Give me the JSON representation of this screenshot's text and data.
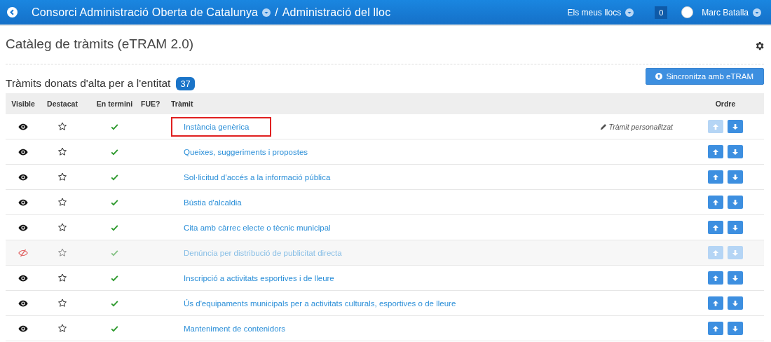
{
  "header": {
    "org": "Consorci Administració Oberta de Catalunya",
    "separator": "/",
    "section": "Administració del lloc",
    "sites_menu": "Els meus llocs",
    "notifications": "0",
    "user": "Marc Batalla"
  },
  "page": {
    "title": "Catàleg de tràmits (eTRAM 2.0)",
    "subtitle": "Tràmits donats d'alta per a l'entitat",
    "count": "37",
    "sync_button": "Sincronitza amb eTRAM"
  },
  "table": {
    "columns": [
      "Visible",
      "Destacat",
      "En termini",
      "FUE?",
      "Tràmit",
      "Ordre"
    ],
    "rows": [
      {
        "visible": true,
        "featured": false,
        "in_term": true,
        "title": "Instància genèrica",
        "highlighted": true,
        "note": "Tràmit personalitzat",
        "disabled": false,
        "up_disabled": true,
        "down_disabled": false
      },
      {
        "visible": true,
        "featured": false,
        "in_term": true,
        "title": "Queixes, suggeriments i propostes",
        "highlighted": false,
        "disabled": false,
        "up_disabled": false,
        "down_disabled": false
      },
      {
        "visible": true,
        "featured": false,
        "in_term": true,
        "title": "Sol·licitud d'accés a la informació pública",
        "highlighted": false,
        "disabled": false,
        "up_disabled": false,
        "down_disabled": false
      },
      {
        "visible": true,
        "featured": false,
        "in_term": true,
        "title": "Bústia d'alcaldia",
        "highlighted": false,
        "disabled": false,
        "up_disabled": false,
        "down_disabled": false
      },
      {
        "visible": true,
        "featured": false,
        "in_term": true,
        "title": "Cita amb càrrec electe o tècnic municipal",
        "highlighted": false,
        "disabled": false,
        "up_disabled": false,
        "down_disabled": false
      },
      {
        "visible": false,
        "featured": false,
        "in_term": true,
        "title": "Denúncia per distribució de publicitat directa",
        "highlighted": false,
        "disabled": true,
        "up_disabled": true,
        "down_disabled": true
      },
      {
        "visible": true,
        "featured": false,
        "in_term": true,
        "title": "Inscripció a activitats esportives i de lleure",
        "highlighted": false,
        "disabled": false,
        "up_disabled": false,
        "down_disabled": false
      },
      {
        "visible": true,
        "featured": false,
        "in_term": true,
        "title": "Ús d'equipaments municipals per a activitats culturals, esportives o de lleure",
        "highlighted": false,
        "disabled": false,
        "up_disabled": false,
        "down_disabled": false
      },
      {
        "visible": true,
        "featured": false,
        "in_term": true,
        "title": "Manteniment de contenidors",
        "highlighted": false,
        "disabled": false,
        "up_disabled": false,
        "down_disabled": false
      }
    ]
  }
}
